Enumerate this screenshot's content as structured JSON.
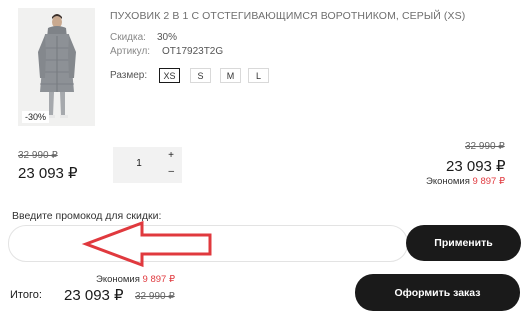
{
  "product": {
    "title": "ПУХОВИК 2 В 1 С ОТСТЕГИВАЮЩИМСЯ ВОРОТНИКОМ, СЕРЫЙ (XS)",
    "discount_badge": "-30%",
    "discount_label": "Скидка:",
    "discount_value": "30%",
    "article_label": "Артикул:",
    "article_value": "OT17923T2G",
    "size_label": "Размер:",
    "sizes": [
      "XS",
      "S",
      "M",
      "L"
    ],
    "selected_size": "XS",
    "old_price": "32 990 ₽",
    "price": "23 093 ₽",
    "quantity": "1",
    "plus": "+",
    "minus": "–"
  },
  "line_total": {
    "old_price": "32 990 ₽",
    "price": "23 093 ₽",
    "economy_label": "Экономия",
    "economy_value": "9 897 ₽"
  },
  "promo": {
    "label": "Введите промокод для скидки:",
    "value": "",
    "placeholder": "",
    "apply_label": "Применить"
  },
  "summary": {
    "economy_label": "Экономия",
    "economy_value": "9 897 ₽",
    "total_label": "Итого:",
    "total_value": "23 093 ₽",
    "total_old": "32 990 ₽",
    "order_label": "Оформить заказ"
  },
  "colors": {
    "accent_red": "#e0393e",
    "button_dark": "#1a1a1a",
    "coat_gray": "#8d9196"
  },
  "icons": [
    "product-photo",
    "arrow-annotation"
  ]
}
